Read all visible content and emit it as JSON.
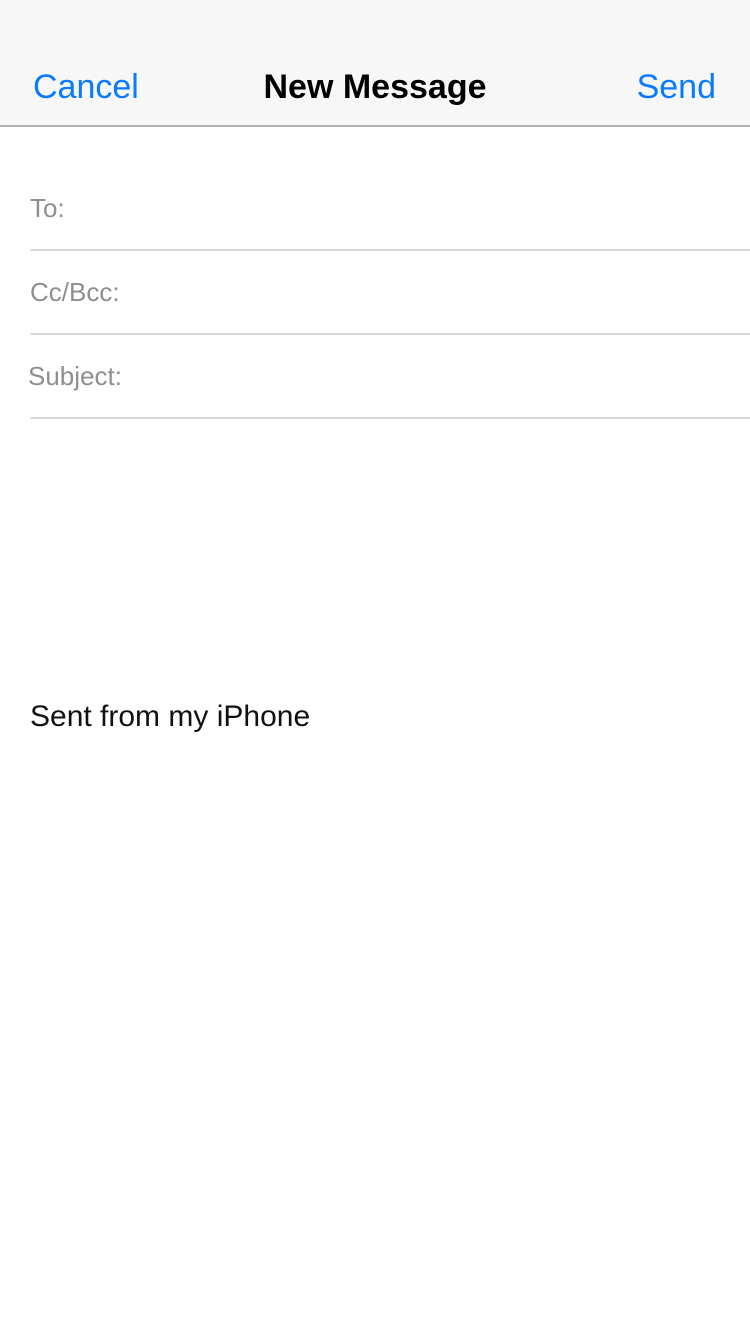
{
  "nav": {
    "cancel_label": "Cancel",
    "title": "New Message",
    "send_label": "Send"
  },
  "fields": {
    "to_label": "To:",
    "to_value": "",
    "ccbcc_label": "Cc/Bcc:",
    "ccbcc_value": "",
    "subject_label": "Subject:",
    "subject_value": ""
  },
  "body": {
    "signature": "Sent from my iPhone"
  },
  "colors": {
    "accent": "#0a7aff",
    "nav_background": "#f7f7f7",
    "label_gray": "#8e8e93",
    "separator": "#dadada"
  }
}
